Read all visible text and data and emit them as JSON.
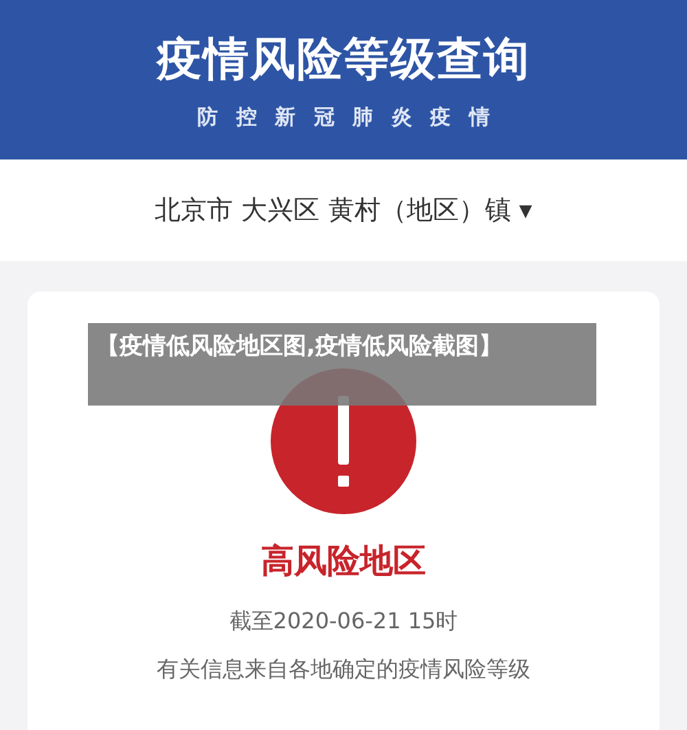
{
  "header": {
    "title": "疫情风险等级查询",
    "subtitle": "防 控 新 冠 肺 炎 疫 情"
  },
  "location": {
    "text": "北京市 大兴区 黄村（地区）镇",
    "caret": "▾"
  },
  "result": {
    "kind": "high",
    "label": "高风险地区",
    "as_of": "截至2020-06-21 15时",
    "note": "有关信息来自各地确定的疫情风险等级"
  },
  "caption": "【疫情低风险地区图,疫情低风险截图】"
}
